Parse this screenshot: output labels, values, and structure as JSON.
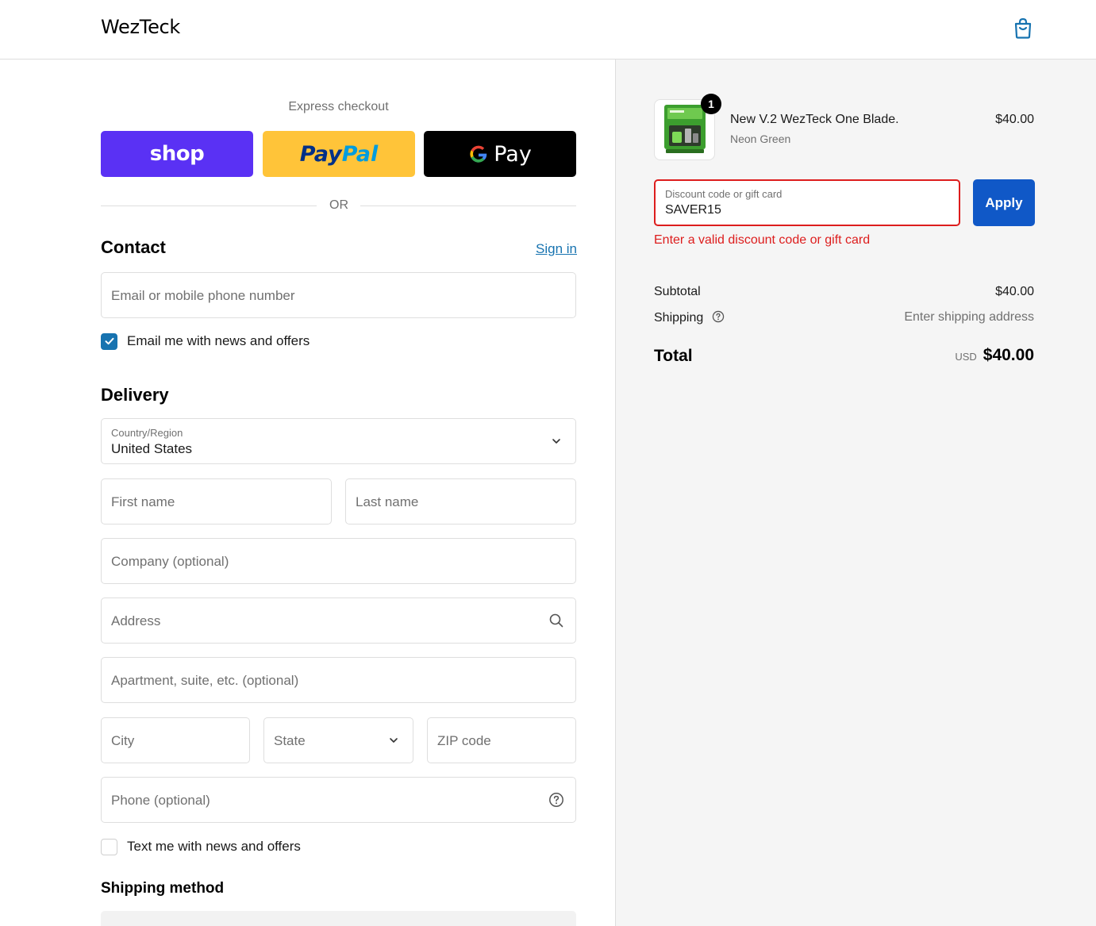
{
  "header": {
    "brand": "WezTeck",
    "cart_icon": "shopping-bag-icon",
    "accent": "#1773b0"
  },
  "express": {
    "label": "Express checkout",
    "shop_label": "shop",
    "paypal_label_1": "Pay",
    "paypal_label_2": "Pal",
    "gpay_g": "G",
    "gpay_label": "Pay",
    "or": "OR"
  },
  "contact": {
    "title": "Contact",
    "sign_in": "Sign in",
    "email_placeholder": "Email or mobile phone number",
    "news_label": "Email me with news and offers",
    "news_checked": true
  },
  "delivery": {
    "title": "Delivery",
    "country_label": "Country/Region",
    "country_value": "United States",
    "first_name": "First name",
    "last_name": "Last name",
    "company": "Company (optional)",
    "address": "Address",
    "apartment": "Apartment, suite, etc. (optional)",
    "city": "City",
    "state": "State",
    "zip": "ZIP code",
    "phone": "Phone (optional)",
    "text_label": "Text me with news and offers",
    "text_checked": false
  },
  "shipping_method": {
    "title": "Shipping method"
  },
  "summary": {
    "item": {
      "quantity": "1",
      "name": "New V.2 WezTeck One Blade.",
      "variant": "Neon Green",
      "price": "$40.00"
    },
    "discount_label": "Discount code or gift card",
    "discount_value": "SAVER15",
    "apply": "Apply",
    "error": "Enter a valid discount code or gift card",
    "subtotal_label": "Subtotal",
    "subtotal_value": "$40.00",
    "shipping_label": "Shipping",
    "shipping_value": "Enter shipping address",
    "total_label": "Total",
    "currency": "USD",
    "total_value": "$40.00",
    "error_color": "#dd1d1d",
    "apply_color": "#1058c7"
  }
}
